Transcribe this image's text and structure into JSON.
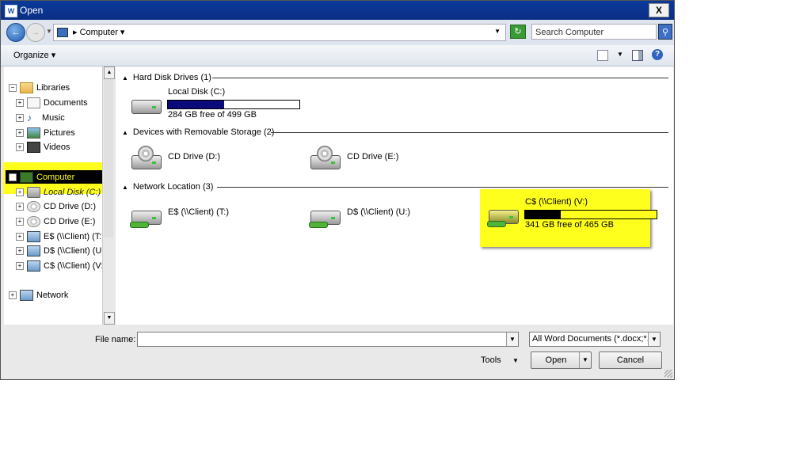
{
  "window": {
    "app_icon": "W",
    "title": "Open",
    "close_label": "X"
  },
  "address": {
    "crumb": "Computer",
    "search_placeholder": "Search Computer"
  },
  "toolbar": {
    "organize_label": "Organize"
  },
  "nav": {
    "libraries": "Libraries",
    "documents": "Documents",
    "music": "Music",
    "pictures": "Pictures",
    "videos": "Videos",
    "computer": "Computer",
    "local_disk": "Local Disk (C:)",
    "cd_d": "CD Drive (D:)",
    "cd_e": "CD Drive (E:)",
    "e_share": "E$ (\\\\Client) (T:)",
    "d_share": "D$ (\\\\Client) (U:)",
    "c_share": "C$ (\\\\Client) (V:)",
    "network": "Network"
  },
  "groups": {
    "hdd": "Hard Disk Drives (1)",
    "removable": "Devices with Removable Storage (2)",
    "network": "Network Location (3)"
  },
  "drives": {
    "c": {
      "name": "Local Disk (C:)",
      "free_text": "284 GB free of 499 GB",
      "used_fraction": 0.43
    },
    "d": {
      "name": "CD Drive (D:)"
    },
    "e": {
      "name": "CD Drive (E:)"
    },
    "t": {
      "name": "E$ (\\\\Client) (T:)"
    },
    "u": {
      "name": "D$ (\\\\Client) (U:)"
    },
    "v": {
      "name": "C$ (\\\\Client) (V:)",
      "free_text": "341 GB free of 465 GB",
      "used_fraction": 0.27
    }
  },
  "bottom": {
    "filename_label": "File name:",
    "filename_value": "",
    "filetype": "All Word Documents (*.docx;*.d",
    "tools_label": "Tools",
    "open_label": "Open",
    "cancel_label": "Cancel"
  },
  "colors": {
    "highlight": "#ffff1e",
    "usage_bar": "#0a0a7a"
  }
}
